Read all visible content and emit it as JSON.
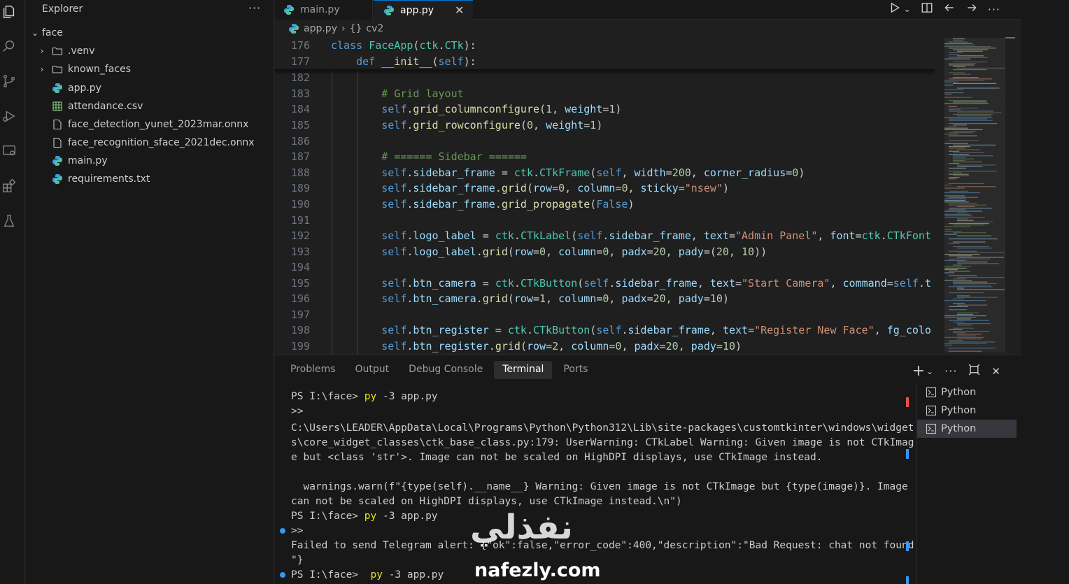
{
  "explorer": {
    "title": "Explorer",
    "more": "···",
    "root": "face",
    "items": [
      {
        "label": ".venv",
        "type": "folder",
        "icon": "folder-icon"
      },
      {
        "label": "known_faces",
        "type": "folder",
        "icon": "folder-icon"
      },
      {
        "label": "app.py",
        "type": "python",
        "icon": "python-icon"
      },
      {
        "label": "attendance.csv",
        "type": "csv",
        "icon": "table-icon"
      },
      {
        "label": "face_detection_yunet_2023mar.onnx",
        "type": "file",
        "icon": "file-icon"
      },
      {
        "label": "face_recognition_sface_2021dec.onnx",
        "type": "file",
        "icon": "file-icon"
      },
      {
        "label": "main.py",
        "type": "python",
        "icon": "python-icon"
      },
      {
        "label": "requirements.txt",
        "type": "file",
        "icon": "file-icon"
      }
    ]
  },
  "tabs": [
    {
      "label": "main.py",
      "active": false
    },
    {
      "label": "app.py",
      "active": true,
      "close": "✕"
    }
  ],
  "breadcrumb": {
    "file": "app.py",
    "sep": "›",
    "symbol_icon": "{}",
    "symbol": "cv2"
  },
  "editor": {
    "lines": [
      {
        "num": "176",
        "html": "<span class=\"kw\">class</span> <span class=\"cls\">FaceApp</span>(<span class=\"cls\">ctk</span>.<span class=\"cls\">CTk</span>):"
      },
      {
        "num": "177",
        "html": "    <span class=\"kw\">def</span> <span class=\"fn\">__init__</span>(<span class=\"self\">self</span>):"
      },
      {
        "num": "182",
        "html": ""
      },
      {
        "num": "183",
        "html": "        <span class=\"cm\"># Grid layout</span>"
      },
      {
        "num": "184",
        "html": "        <span class=\"self\">self</span>.<span class=\"fn\">grid_columnconfigure</span>(<span class=\"num\">1</span>, <span class=\"param\">weight</span>=<span class=\"num\">1</span>)"
      },
      {
        "num": "185",
        "html": "        <span class=\"self\">self</span>.<span class=\"fn\">grid_rowconfigure</span>(<span class=\"num\">0</span>, <span class=\"param\">weight</span>=<span class=\"num\">1</span>)"
      },
      {
        "num": "186",
        "html": ""
      },
      {
        "num": "187",
        "html": "        <span class=\"cm\"># ====== Sidebar ======</span>"
      },
      {
        "num": "188",
        "html": "        <span class=\"self\">self</span>.<span class=\"param\">sidebar_frame</span> = <span class=\"cls\">ctk</span>.<span class=\"cls\">CTkFrame</span>(<span class=\"self\">self</span>, <span class=\"param\">width</span>=<span class=\"num\">200</span>, <span class=\"param\">corner_radius</span>=<span class=\"num\">0</span>)"
      },
      {
        "num": "189",
        "html": "        <span class=\"self\">self</span>.<span class=\"param\">sidebar_frame</span>.<span class=\"fn\">grid</span>(<span class=\"param\">row</span>=<span class=\"num\">0</span>, <span class=\"param\">column</span>=<span class=\"num\">0</span>, <span class=\"param\">sticky</span>=<span class=\"str\">\"nsew\"</span>)"
      },
      {
        "num": "190",
        "html": "        <span class=\"self\">self</span>.<span class=\"param\">sidebar_frame</span>.<span class=\"fn\">grid_propagate</span>(<span class=\"kw\">False</span>)"
      },
      {
        "num": "191",
        "html": ""
      },
      {
        "num": "192",
        "html": "        <span class=\"self\">self</span>.<span class=\"param\">logo_label</span> = <span class=\"cls\">ctk</span>.<span class=\"cls\">CTkLabel</span>(<span class=\"self\">self</span>.<span class=\"param\">sidebar_frame</span>, <span class=\"param\">text</span>=<span class=\"str\">\"Admin Panel\"</span>, <span class=\"param\">font</span>=<span class=\"cls\">ctk</span>.<span class=\"cls\">CTkFont</span>"
      },
      {
        "num": "193",
        "html": "        <span class=\"self\">self</span>.<span class=\"param\">logo_label</span>.<span class=\"fn\">grid</span>(<span class=\"param\">row</span>=<span class=\"num\">0</span>, <span class=\"param\">column</span>=<span class=\"num\">0</span>, <span class=\"param\">padx</span>=<span class=\"num\">20</span>, <span class=\"param\">pady</span>=(<span class=\"num\">20</span>, <span class=\"num\">10</span>))"
      },
      {
        "num": "194",
        "html": ""
      },
      {
        "num": "195",
        "html": "        <span class=\"self\">self</span>.<span class=\"param\">btn_camera</span> = <span class=\"cls\">ctk</span>.<span class=\"cls\">CTkButton</span>(<span class=\"self\">self</span>.<span class=\"param\">sidebar_frame</span>, <span class=\"param\">text</span>=<span class=\"str\">\"Start Camera\"</span>, <span class=\"param\">command</span>=<span class=\"self\">self</span>.<span class=\"param\">t</span>"
      },
      {
        "num": "196",
        "html": "        <span class=\"self\">self</span>.<span class=\"param\">btn_camera</span>.<span class=\"fn\">grid</span>(<span class=\"param\">row</span>=<span class=\"num\">1</span>, <span class=\"param\">column</span>=<span class=\"num\">0</span>, <span class=\"param\">padx</span>=<span class=\"num\">20</span>, <span class=\"param\">pady</span>=<span class=\"num\">10</span>)"
      },
      {
        "num": "197",
        "html": ""
      },
      {
        "num": "198",
        "html": "        <span class=\"self\">self</span>.<span class=\"param\">btn_register</span> = <span class=\"cls\">ctk</span>.<span class=\"cls\">CTkButton</span>(<span class=\"self\">self</span>.<span class=\"param\">sidebar_frame</span>, <span class=\"param\">text</span>=<span class=\"str\">\"Register New Face\"</span>, <span class=\"param\">fg_colo</span>"
      },
      {
        "num": "199",
        "html": "        <span class=\"self\">self</span>.<span class=\"param\">btn_register</span>.<span class=\"fn\">grid</span>(<span class=\"param\">row</span>=<span class=\"num\">2</span>, <span class=\"param\">column</span>=<span class=\"num\">0</span>, <span class=\"param\">padx</span>=<span class=\"num\">20</span>, <span class=\"param\">pady</span>=<span class=\"num\">10</span>)"
      }
    ]
  },
  "panel": {
    "tabs": [
      "Problems",
      "Output",
      "Debug Console",
      "Terminal",
      "Ports"
    ],
    "active_tab": "Terminal",
    "terminal_lines": [
      {
        "segments": [
          {
            "t": "PS I:\\face> "
          },
          {
            "t": "py",
            "c": "yellow"
          },
          {
            "t": " -3 app.py"
          }
        ],
        "dot": false
      },
      {
        "segments": [
          {
            "t": ">>"
          }
        ],
        "dot": false
      },
      {
        "segments": [
          {
            "t": "C:\\Users\\LEADER\\AppData\\Local\\Programs\\Python\\Python312\\Lib\\site-packages\\customtkinter\\windows\\widget"
          }
        ],
        "dot": false
      },
      {
        "segments": [
          {
            "t": "s\\core_widget_classes\\ctk_base_class.py:179: UserWarning: CTkLabel Warning: Given image is not CTkImag"
          }
        ],
        "dot": false
      },
      {
        "segments": [
          {
            "t": "e but <class 'str'>. Image can not be scaled on HighDPI displays, use CTkImage instead."
          }
        ],
        "dot": false
      },
      {
        "segments": [
          {
            "t": ""
          }
        ],
        "dot": false
      },
      {
        "segments": [
          {
            "t": "  warnings.warn(f\"{type(self).__name__} Warning: Given image is not CTkImage but {type(image)}. Image"
          }
        ],
        "dot": false
      },
      {
        "segments": [
          {
            "t": "can not be scaled on HighDPI displays, use CTkImage instead.\\n\")"
          }
        ],
        "dot": false
      },
      {
        "segments": [
          {
            "t": "PS I:\\face> "
          },
          {
            "t": "py",
            "c": "yellow"
          },
          {
            "t": " -3 app.py"
          }
        ],
        "dot": false
      },
      {
        "segments": [
          {
            "t": ">>"
          }
        ],
        "dot": true
      },
      {
        "segments": [
          {
            "t": "Failed to send Telegram alert: {\"ok\":false,\"error_code\":400,\"description\":\"Bad Request: chat not found"
          }
        ],
        "dot": false
      },
      {
        "segments": [
          {
            "t": "\"}"
          }
        ],
        "dot": false
      },
      {
        "segments": [
          {
            "t": "PS I:\\face>  "
          },
          {
            "t": "py",
            "c": "yellow"
          },
          {
            "t": " -3 app.py"
          }
        ],
        "dot": true
      }
    ],
    "terminals": [
      "Python",
      "Python",
      "Python"
    ],
    "selected_terminal": 2
  },
  "watermark": {
    "arabic": "نفذلي",
    "latin": "nafezly.com"
  },
  "colors": {
    "accent": "#0078d4",
    "bg": "#1f1f1f",
    "sidebar": "#181818"
  }
}
